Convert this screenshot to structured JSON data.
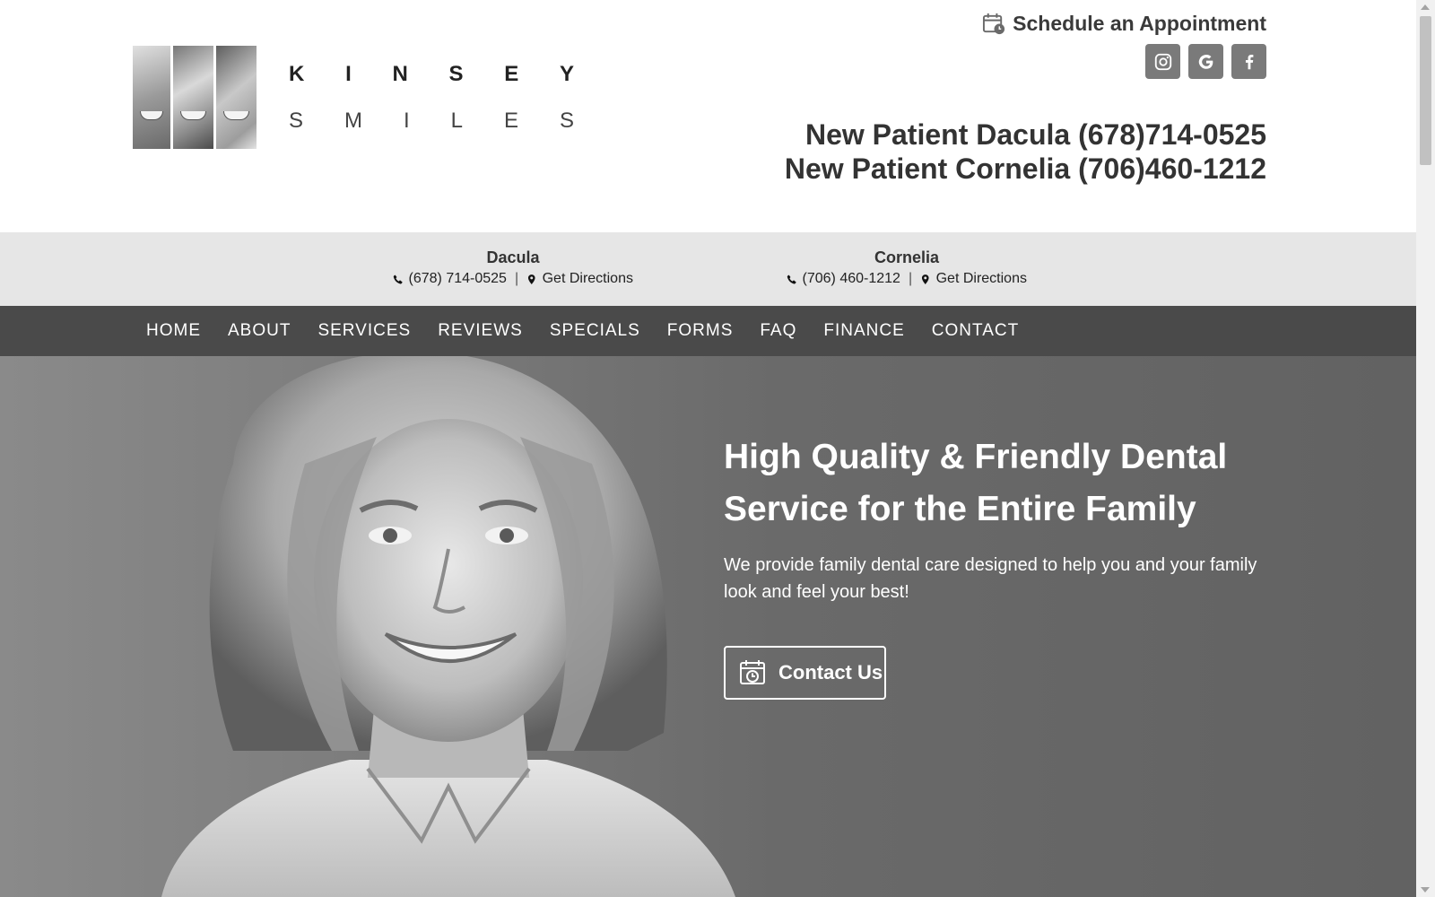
{
  "header": {
    "logo": {
      "line1": [
        "K",
        "I",
        "N",
        "S",
        "E",
        "Y"
      ],
      "line2": [
        "S",
        "M",
        "I",
        "L",
        "E",
        "S"
      ]
    },
    "schedule_label": "Schedule an Appointment",
    "socials": [
      {
        "name": "instagram-icon"
      },
      {
        "name": "google-icon"
      },
      {
        "name": "facebook-icon"
      }
    ],
    "phones": [
      "New Patient Dacula (678)714-0525",
      "New Patient Cornelia (706)460-1212"
    ]
  },
  "locations": [
    {
      "name": "Dacula",
      "phone": "(678) 714-0525",
      "directions": "Get Directions"
    },
    {
      "name": "Cornelia",
      "phone": "(706) 460-1212",
      "directions": "Get Directions"
    }
  ],
  "nav": [
    {
      "label": "HOME"
    },
    {
      "label": "ABOUT"
    },
    {
      "label": "SERVICES"
    },
    {
      "label": "REVIEWS"
    },
    {
      "label": "SPECIALS"
    },
    {
      "label": "FORMS"
    },
    {
      "label": "FAQ"
    },
    {
      "label": "FINANCE"
    },
    {
      "label": "CONTACT"
    }
  ],
  "hero": {
    "title": "High Quality & Friendly Dental Service for the Entire Family",
    "subtitle": "We provide family dental care designed to help you and your family look and feel your best!",
    "cta_label": "Contact Us"
  },
  "colors": {
    "nav_bg": "#4a4a4a",
    "locations_bg": "#e6e6e6",
    "social_bg": "#7a7a7a",
    "hero_bg": "#696969"
  }
}
